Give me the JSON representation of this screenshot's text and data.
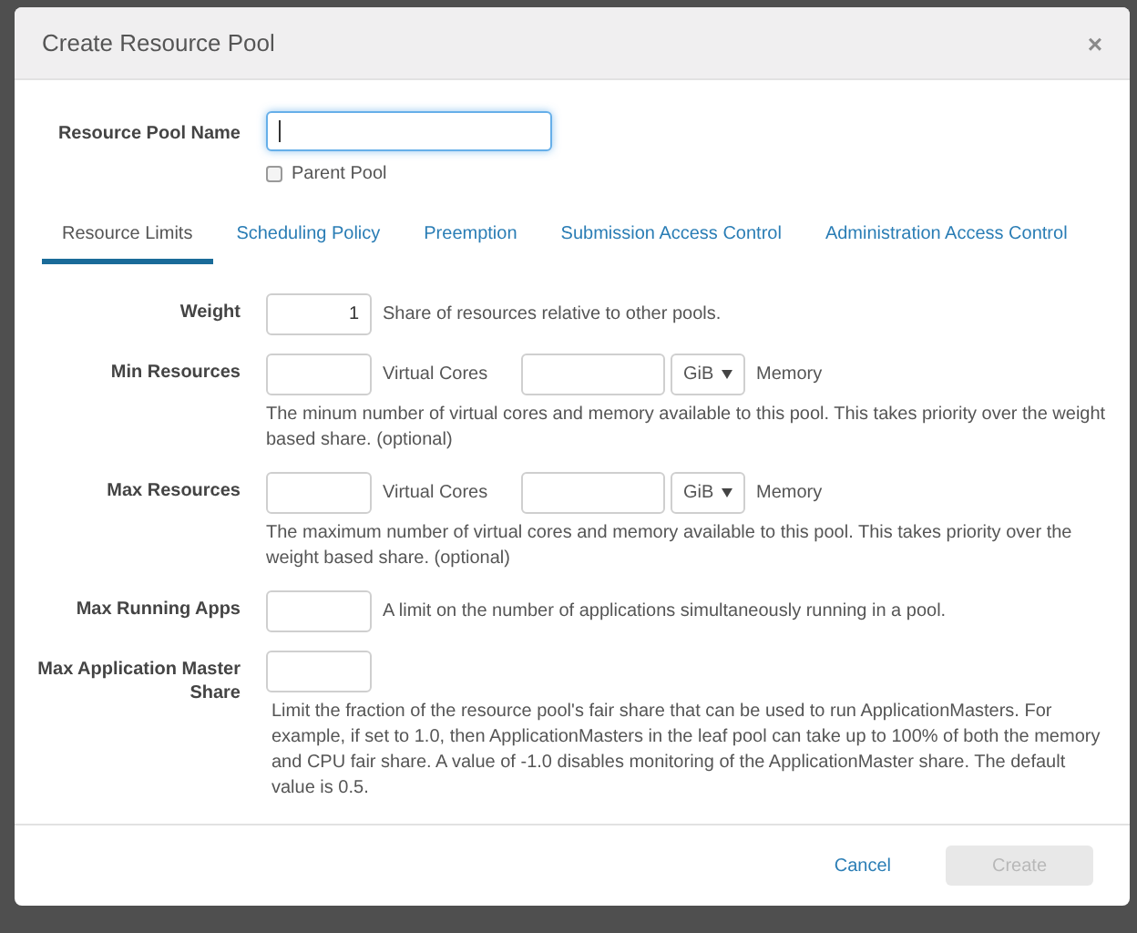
{
  "dialog": {
    "title": "Create Resource Pool",
    "close": "×"
  },
  "name_field": {
    "label": "Resource Pool Name",
    "focused": true
  },
  "parent_pool": {
    "label": "Parent Pool",
    "checked": false
  },
  "tabs": [
    {
      "label": "Resource Limits",
      "selected": true
    },
    {
      "label": "Scheduling Policy",
      "selected": false
    },
    {
      "label": "Preemption",
      "selected": false
    },
    {
      "label": "Submission Access Control",
      "selected": false
    },
    {
      "label": "Administration Access Control",
      "selected": false
    }
  ],
  "rows": [
    {
      "kind": "single",
      "label": "Weight",
      "value": "1",
      "hint": "Share of resources relative to other pools."
    },
    {
      "kind": "resources",
      "label": "Min Resources",
      "cores_label": "Virtual Cores",
      "unit": "GiB",
      "memory_label": "Memory",
      "help": "The minum number of virtual cores and memory available to this pool. This takes priority over the weight based share. (optional)"
    },
    {
      "kind": "resources",
      "label": "Max Resources",
      "cores_label": "Virtual Cores",
      "unit": "GiB",
      "memory_label": "Memory",
      "help": "The maximum number of virtual cores and memory available to this pool. This takes priority over the weight based share. (optional)"
    },
    {
      "kind": "single",
      "label": "Max Running Apps",
      "hint": "A limit on the number of applications simultaneously running in a pool."
    },
    {
      "kind": "stacked",
      "label": "Max Application Master Share",
      "help": "Limit the fraction of the resource pool's fair share that can be used to run ApplicationMasters. For example, if set to 1.0, then ApplicationMasters in the leaf pool can take up to 100% of both the memory and CPU fair share. A value of -1.0 disables monitoring of the ApplicationMaster share. The default value is 0.5."
    }
  ],
  "buttons": {
    "cancel": "Cancel",
    "create": {
      "label": "Create",
      "disabled": true
    }
  }
}
